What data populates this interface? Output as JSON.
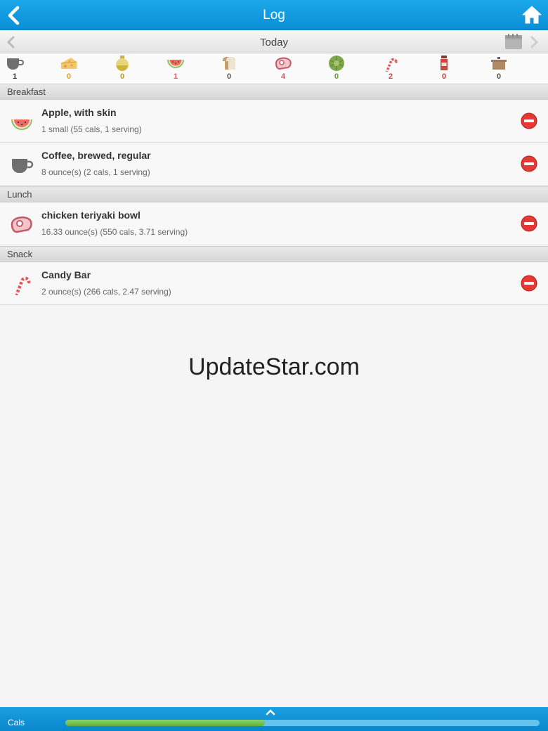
{
  "header": {
    "title": "Log"
  },
  "date_nav": {
    "label": "Today"
  },
  "food_groups": [
    {
      "icon": "coffee-cup-icon",
      "count": "1",
      "color": "#333333"
    },
    {
      "icon": "cheese-icon",
      "count": "0",
      "color": "#d4a531"
    },
    {
      "icon": "oil-bottle-icon",
      "count": "0",
      "color": "#b8a21e"
    },
    {
      "icon": "watermelon-icon",
      "count": "1",
      "color": "#d0665e"
    },
    {
      "icon": "bread-icon",
      "count": "0",
      "color": "#555555"
    },
    {
      "icon": "meat-icon",
      "count": "4",
      "color": "#c35a6a"
    },
    {
      "icon": "artichoke-icon",
      "count": "0",
      "color": "#6b9a3a"
    },
    {
      "icon": "candy-cane-icon",
      "count": "2",
      "color": "#d04848"
    },
    {
      "icon": "sauce-bottle-icon",
      "count": "0",
      "color": "#b5443a"
    },
    {
      "icon": "casserole-icon",
      "count": "0",
      "color": "#555555"
    }
  ],
  "meals": {
    "breakfast": {
      "label": "Breakfast",
      "items": [
        {
          "icon": "watermelon-icon",
          "name": "Apple, with skin",
          "detail": "1 small (55 cals, 1 serving)"
        },
        {
          "icon": "coffee-cup-icon",
          "name": "Coffee, brewed, regular",
          "detail": "8 ounce(s) (2 cals, 1 serving)"
        }
      ]
    },
    "lunch": {
      "label": "Lunch",
      "items": [
        {
          "icon": "meat-icon",
          "name": "chicken teriyaki bowl",
          "detail": "16.33 ounce(s) (550 cals, 3.71 serving)"
        }
      ]
    },
    "snack": {
      "label": "Snack",
      "items": [
        {
          "icon": "candy-cane-icon",
          "name": "Candy Bar",
          "detail": "2 ounce(s) (266 cals, 2.47 serving)"
        }
      ]
    }
  },
  "watermark": "UpdateStar.com",
  "footer": {
    "label": "Cals",
    "progress_fraction": 0.42
  }
}
